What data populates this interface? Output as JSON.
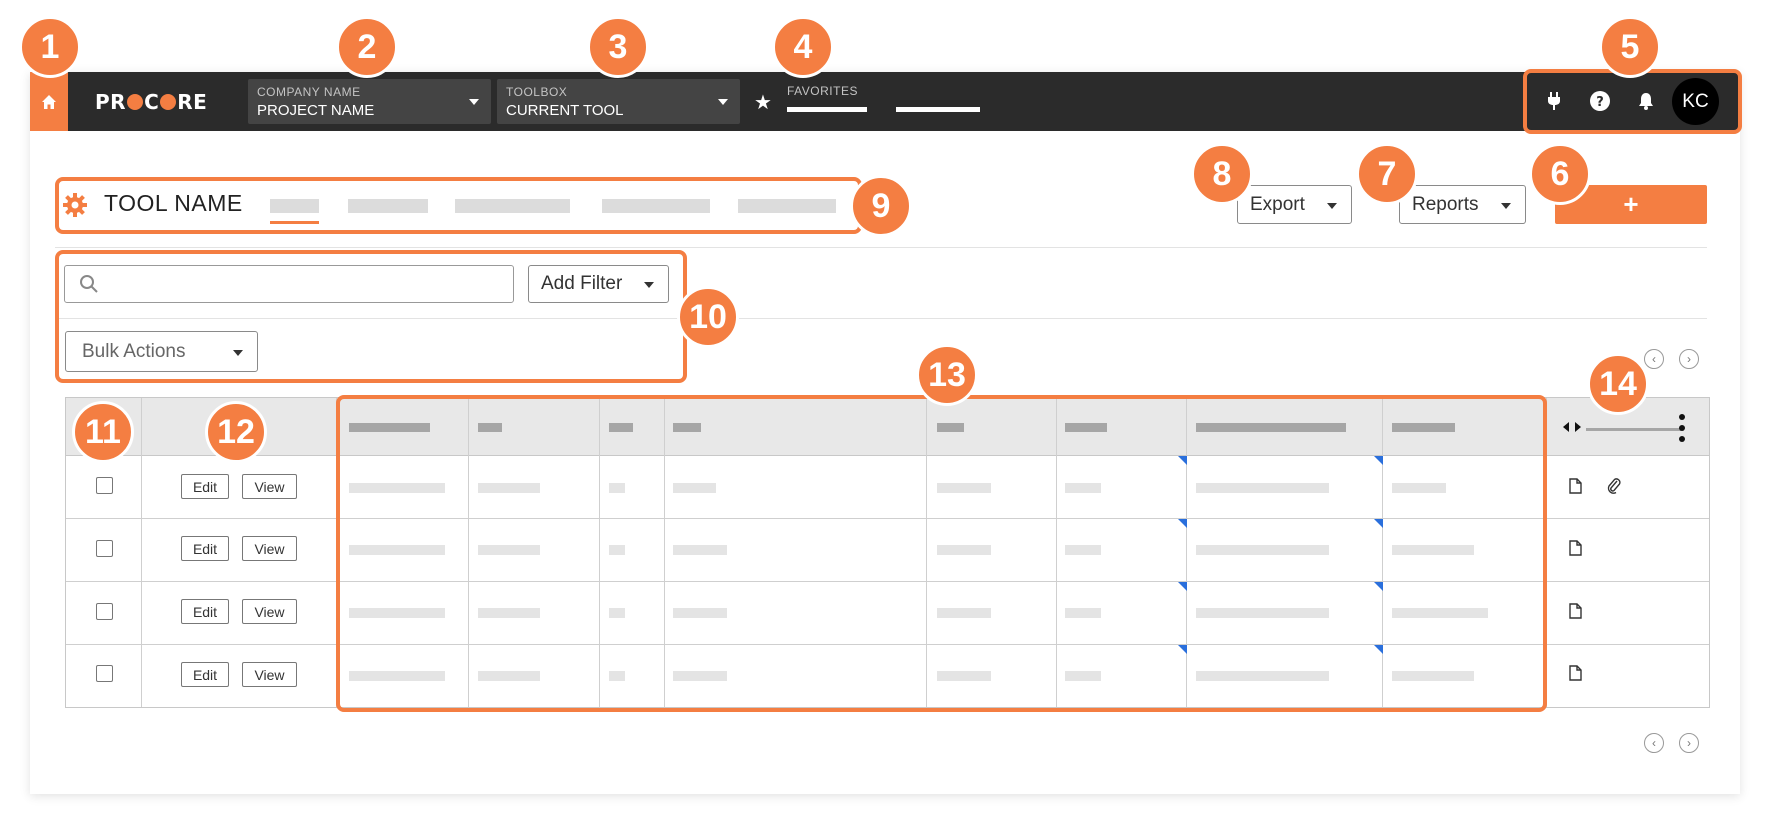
{
  "nav": {
    "logo_text_1": "PR",
    "logo_text_2": "C",
    "logo_text_3": "RE",
    "company": {
      "label": "COMPANY NAME",
      "value": "PROJECT NAME"
    },
    "toolbox": {
      "label": "TOOLBOX",
      "value": "CURRENT TOOL"
    },
    "favorites_label": "FAVORITES",
    "avatar_initials": "KC"
  },
  "tool": {
    "name": "TOOL NAME",
    "export_label": "Export",
    "reports_label": "Reports",
    "create_label": "+"
  },
  "filters": {
    "add_filter_label": "Add Filter",
    "bulk_actions_label": "Bulk Actions"
  },
  "table": {
    "rows": [
      {
        "edit_label": "Edit",
        "view_label": "View"
      },
      {
        "edit_label": "Edit",
        "view_label": "View"
      },
      {
        "edit_label": "Edit",
        "view_label": "View"
      },
      {
        "edit_label": "Edit",
        "view_label": "View"
      }
    ]
  },
  "callouts": [
    "1",
    "2",
    "3",
    "4",
    "5",
    "6",
    "7",
    "8",
    "9",
    "10",
    "11",
    "12",
    "13",
    "14"
  ],
  "colors": {
    "accent": "#f47e42",
    "nav_bg": "#2b2b2b",
    "marker": "#2a6fdc"
  }
}
